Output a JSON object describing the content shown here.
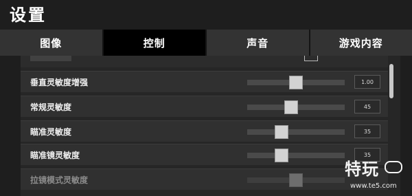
{
  "header": {
    "title": "设置"
  },
  "tabs": [
    {
      "label": "图像",
      "active": false
    },
    {
      "label": "控制",
      "active": true
    },
    {
      "label": "声音",
      "active": false
    },
    {
      "label": "游戏内容",
      "active": false
    }
  ],
  "settings": [
    {
      "label": "垂直灵敏度增强",
      "value": "1.00",
      "level": 0.5,
      "disabled": false
    },
    {
      "label": "常规灵敏度",
      "value": "45",
      "level": 0.45,
      "disabled": false
    },
    {
      "label": "瞄准灵敏度",
      "value": "35",
      "level": 0.35,
      "disabled": false
    },
    {
      "label": "瞄准镜灵敏度",
      "value": "35",
      "level": 0.35,
      "disabled": false
    },
    {
      "label": "拉镜模式灵敏度",
      "value": "",
      "level": 0.5,
      "disabled": true
    }
  ],
  "watermark": {
    "text": "特玩",
    "url": "www.te5.com",
    "icon": "gamepad-icon"
  },
  "colors": {
    "tab_bg": "#333333",
    "tab_active": "#000000",
    "row_bg": "#303030",
    "thumb": "#d2d2d2"
  }
}
